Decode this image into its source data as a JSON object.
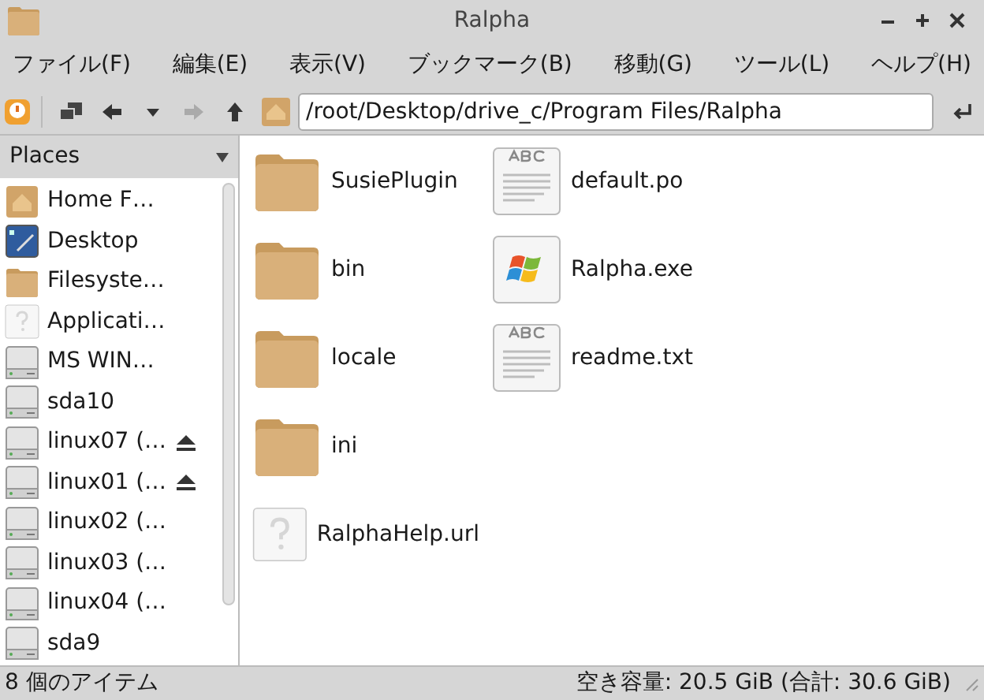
{
  "window": {
    "title": "Ralpha"
  },
  "menu": [
    "ファイル(F)",
    "編集(E)",
    "表示(V)",
    "ブックマーク(B)",
    "移動(G)",
    "ツール(L)",
    "ヘルプ(H)"
  ],
  "location": {
    "value": "/root/Desktop/drive_c/Program Files/Ralpha"
  },
  "sidebar": {
    "title": "Places",
    "items": [
      {
        "kind": "home",
        "label": "Home F…",
        "eject": false
      },
      {
        "kind": "desktop",
        "label": "Desktop",
        "eject": false
      },
      {
        "kind": "folder",
        "label": "Filesyste…",
        "eject": false
      },
      {
        "kind": "unknown",
        "label": "Applicati…",
        "eject": false
      },
      {
        "kind": "drive",
        "label": "MS WIN…",
        "eject": false
      },
      {
        "kind": "drive",
        "label": "sda10",
        "eject": false
      },
      {
        "kind": "drive",
        "label": "linux07 (…",
        "eject": true
      },
      {
        "kind": "drive",
        "label": "linux01 (…",
        "eject": true
      },
      {
        "kind": "drive",
        "label": "linux02 (…",
        "eject": false
      },
      {
        "kind": "drive",
        "label": "linux03 (…",
        "eject": false
      },
      {
        "kind": "drive",
        "label": "linux04 (…",
        "eject": false
      },
      {
        "kind": "drive",
        "label": "sda9",
        "eject": false
      }
    ]
  },
  "files": [
    {
      "kind": "folder",
      "name": "SusiePlugin"
    },
    {
      "kind": "folder",
      "name": "bin"
    },
    {
      "kind": "folder",
      "name": "locale"
    },
    {
      "kind": "folder",
      "name": "ini"
    },
    {
      "kind": "unknown",
      "name": "RalphaHelp.url"
    },
    {
      "kind": "text",
      "name": "default.po"
    },
    {
      "kind": "exe",
      "name": "Ralpha.exe"
    },
    {
      "kind": "text",
      "name": "readme.txt"
    }
  ],
  "status_bar": {
    "count": "8 個のアイテム",
    "free_space": "空き容量: 20.5 GiB (合計: 30.6 GiB)"
  }
}
